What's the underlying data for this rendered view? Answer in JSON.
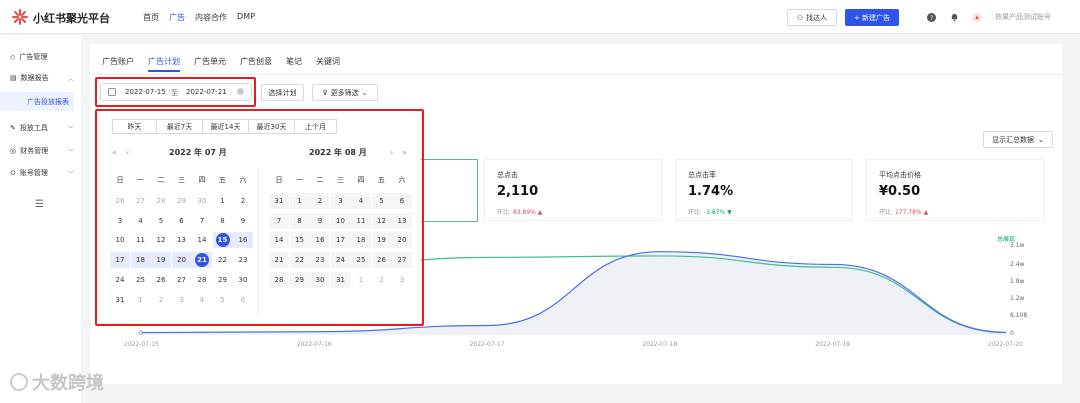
{
  "header": {
    "brand": "小红书聚光平台",
    "nav": [
      "首页",
      "广告",
      "内容合作",
      "DMP"
    ],
    "active_nav": 1,
    "find_talent": "找达人",
    "new_ad": "+ 新建广告",
    "account": "效果产品测试账号"
  },
  "sidebar": {
    "items": [
      {
        "label": "广告管理",
        "icon": "tag-icon"
      },
      {
        "label": "数据报告",
        "icon": "report-icon"
      },
      {
        "label": "投放工具",
        "icon": "tool-icon"
      },
      {
        "label": "财务管理",
        "icon": "finance-icon"
      },
      {
        "label": "账号管理",
        "icon": "account-icon"
      }
    ],
    "sub_item": "广告投放报表"
  },
  "tabs": [
    "广告账户",
    "广告计划",
    "广告单元",
    "广告创意",
    "笔记",
    "关键词"
  ],
  "active_tab": 1,
  "date_range": {
    "start": "2022-07-15",
    "separator": "至",
    "end": "2022-07-21"
  },
  "buttons": {
    "select_plan": "选择计划",
    "more_filter": "更多筛选",
    "summary_select": "显示汇总数据"
  },
  "picker": {
    "presets": [
      "昨天",
      "最近7天",
      "最近14天",
      "最近30天",
      "上个月"
    ],
    "left_title": "2022 年 07 月",
    "right_title": "2022 年 08 月",
    "weekdays": [
      "日",
      "一",
      "二",
      "三",
      "四",
      "五",
      "六"
    ],
    "left_days": [
      [
        "26",
        "27",
        "28",
        "29",
        "30",
        "1",
        "2"
      ],
      [
        "3",
        "4",
        "5",
        "6",
        "7",
        "8",
        "9"
      ],
      [
        "10",
        "11",
        "12",
        "13",
        "14",
        "15",
        "16"
      ],
      [
        "17",
        "18",
        "19",
        "20",
        "21",
        "22",
        "23"
      ],
      [
        "24",
        "25",
        "26",
        "27",
        "28",
        "29",
        "30"
      ],
      [
        "31",
        "1",
        "2",
        "3",
        "4",
        "5",
        "6"
      ]
    ],
    "right_days": [
      [
        "31",
        "1",
        "2",
        "3",
        "4",
        "5",
        "6"
      ],
      [
        "7",
        "8",
        "9",
        "10",
        "11",
        "12",
        "13"
      ],
      [
        "14",
        "15",
        "16",
        "17",
        "18",
        "19",
        "20"
      ],
      [
        "21",
        "22",
        "23",
        "24",
        "25",
        "26",
        "27"
      ],
      [
        "28",
        "29",
        "30",
        "31",
        "1",
        "2",
        "3"
      ]
    ]
  },
  "stats": [
    {
      "label": "总点击",
      "value": "2,110",
      "compare_label": "环比:",
      "compare_value": "83.89%",
      "trend": "up"
    },
    {
      "label": "总点击率",
      "value": "1.74%",
      "compare_label": "环比:",
      "compare_value": "-3.87%",
      "trend": "down"
    },
    {
      "label": "平均点击价格",
      "value": "¥0.50",
      "compare_label": "环比:",
      "compare_value": "177.78%",
      "trend": "up"
    }
  ],
  "chart_data": {
    "type": "line",
    "x": [
      "2022-07-15",
      "2022-07-16",
      "2022-07-17",
      "2022-07-18",
      "2022-07-19",
      "2022-07-20"
    ],
    "y_right_ticks": [
      "3.1w",
      "2.4w",
      "1.8w",
      "1.2w",
      "6,108",
      "0"
    ],
    "y_left_ticks": [
      "0"
    ],
    "legend": "总展现",
    "series": [
      {
        "name": "总展现",
        "color": "#3fbf8c",
        "values": [
          15500,
          23500,
          27000,
          27500,
          23500,
          500
        ]
      },
      {
        "name": "",
        "color": "#4a6cf7",
        "values": [
          500,
          800,
          3000,
          29000,
          24500,
          600
        ]
      }
    ]
  },
  "watermark": "大数跨境"
}
